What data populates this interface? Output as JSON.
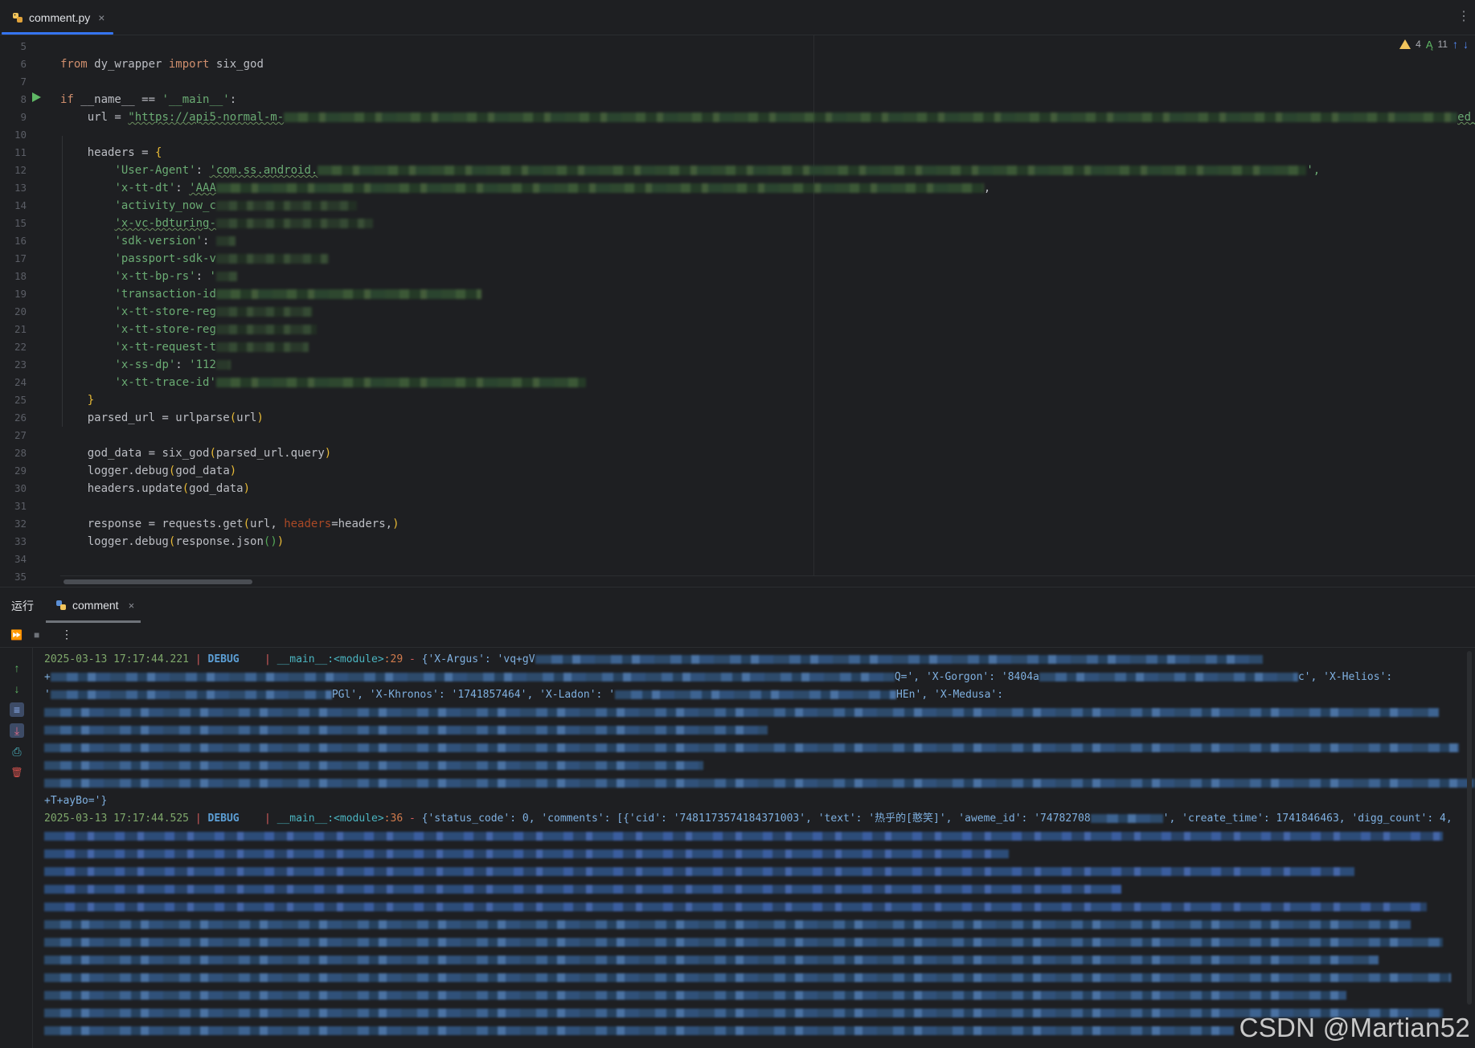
{
  "tab_bar": {
    "active_tab": "comment.py",
    "close_glyph": "×",
    "menu_glyph": "⋮"
  },
  "inspections": {
    "warnings": "4",
    "typos": "11",
    "prev_glyph": "↑",
    "next_glyph": "↓"
  },
  "editor": {
    "line_numbers": [
      "5",
      "6",
      "7",
      "8",
      "9",
      "10",
      "11",
      "12",
      "13",
      "14",
      "15",
      "16",
      "17",
      "18",
      "19",
      "20",
      "21",
      "22",
      "23",
      "24",
      "25",
      "26",
      "27",
      "28",
      "29",
      "30",
      "31",
      "32",
      "33",
      "34",
      "35"
    ],
    "line6": {
      "kw_from": "from",
      "module": " dy_wrapper ",
      "kw_import": "import",
      "name": " six_god"
    },
    "line8": {
      "kw_if": "if",
      "text": " __name__ == ",
      "str": "'__main__'",
      "colon": ":"
    },
    "line9": {
      "prefix": "    url = ",
      "str_start": "\"https://api5-normal-m-",
      "str_end": "ed_co"
    },
    "line11": {
      "text": "    headers = ",
      "brace": "{"
    },
    "line12": {
      "key": "'User-Agent'",
      "sep": ": ",
      "val": "'com.ss.android.",
      "tail": "',"
    },
    "line13": {
      "key": "'x-tt-dt'",
      "sep": ": ",
      "val": "'AAA",
      "tail": ","
    },
    "line14": {
      "key": "'activity_now_c"
    },
    "line15": {
      "key": "'x-vc-bdturing-"
    },
    "line16": {
      "key": "'sdk-version'",
      "sep": ": "
    },
    "line17": {
      "key": "'passport-sdk-v"
    },
    "line18": {
      "key": "'x-tt-bp-rs'",
      "sep": ": ",
      "val": "'"
    },
    "line19": {
      "key": "'transaction-id"
    },
    "line20": {
      "key": "'x-tt-store-reg"
    },
    "line21": {
      "key": "'x-tt-store-reg"
    },
    "line22": {
      "key": "'x-tt-request-t"
    },
    "line23": {
      "key": "'x-ss-dp'",
      "sep": ": ",
      "val": "'112"
    },
    "line24": {
      "key": "'x-tt-trace-id'"
    },
    "line25": {
      "brace": "}"
    },
    "line26": {
      "lhs": "    parsed_url = ",
      "fn": "urlparse",
      "open": "(",
      "arg": "url",
      "close": ")"
    },
    "line28": {
      "lhs": "    god_data = ",
      "fn": "six_god",
      "open": "(",
      "arg": "parsed_url.query",
      "close": ")"
    },
    "line29": {
      "lhs": "    logger.",
      "fn": "debug",
      "open": "(",
      "arg": "god_data",
      "close": ")"
    },
    "line30": {
      "lhs": "    headers.",
      "fn": "update",
      "open": "(",
      "arg": "god_data",
      "close": ")"
    },
    "line32": {
      "lhs": "    response = requests.",
      "fn": "get",
      "open": "(",
      "arg1": "url, ",
      "kwarg": "headers",
      "arg2": "=headers,",
      "close": ")"
    },
    "line33": {
      "lhs": "    logger.",
      "fn": "debug",
      "open": "(",
      "arg": "response.json",
      "inner": "()",
      "close": ")"
    }
  },
  "run_panel": {
    "title": "运行",
    "tab": "comment",
    "close_glyph": "×",
    "toolbar": {
      "rerun_glyph": "⏩",
      "stop_glyph": "■",
      "more_glyph": "⋮"
    },
    "side_tools": {
      "up": "↑",
      "down": "↓",
      "wrap": "≡",
      "scroll_end": "⤓",
      "print": "⎙",
      "clear": "🗑"
    }
  },
  "console": {
    "log1": {
      "time": "2025-03-13 17:17:44.221",
      "pipe": " | ",
      "level": "DEBUG",
      "pad": "    ",
      "pipe2": "| ",
      "module": "__main__:<module>",
      "lineno": ":29",
      "dash": " - ",
      "msg": "{'X-Argus': 'vq+gV"
    },
    "log1_l2": {
      "prefix": "+",
      "a": "Q=', 'X-Gorgon': '8404a",
      "b": "c', 'X-Helios':"
    },
    "log1_l3": {
      "prefix": "'",
      "a": "PGl', 'X-Khronos': '1741857464', 'X-Ladon': '",
      "b": "HEn', 'X-Medusa':"
    },
    "log1_end": "+T+ayBo='}",
    "log2": {
      "time": "2025-03-13 17:17:44.525",
      "pipe": " | ",
      "level": "DEBUG",
      "pad": "    ",
      "pipe2": "| ",
      "module": "__main__:<module>",
      "lineno": ":36",
      "dash": " - ",
      "msg_a": "{'status_code': 0, 'comments': [{'cid': '7481173574184371003', 'text': '热乎的[憨笑]', 'aweme_id': '74782708",
      "msg_b": "', 'create_time': 1741846463, 'digg_count': 4,"
    }
  },
  "watermark": "CSDN @Martian52"
}
